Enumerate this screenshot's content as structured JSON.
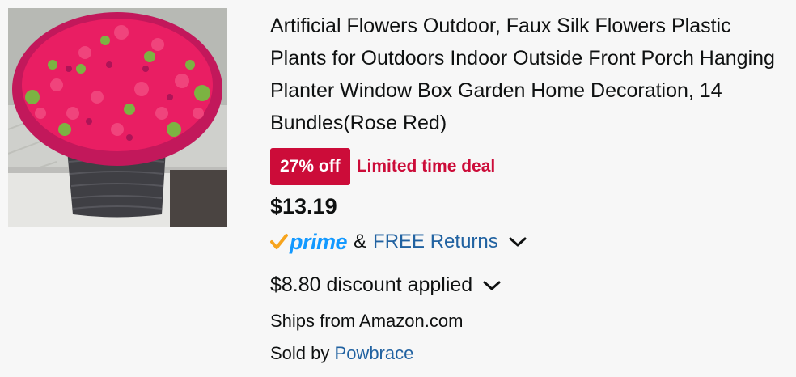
{
  "product": {
    "image_alt": "Rose red artificial flowers in dark woven planter",
    "title": "Artificial Flowers Outdoor, Faux Silk Flowers Plastic Plants for Outdoors Indoor Outside Front Porch Hanging Planter Window Box Garden Home Decoration, 14 Bundles(Rose Red)",
    "deal_badge": "27% off",
    "deal_text": "Limited time deal",
    "price": "$13.19",
    "prime_label": "prime",
    "amp": "&",
    "returns_label": "FREE Returns",
    "discount_label": "$8.80 discount applied",
    "ships_label": "Ships from Amazon.com",
    "sold_by_prefix": "Sold by",
    "seller_name": "Powbrace"
  },
  "colors": {
    "deal_red": "#cc0c39",
    "link_blue": "#2162a1",
    "prime_blue": "#1399ff",
    "prime_check": "#f7a41d",
    "background": "#f7f7f7"
  },
  "icons": {
    "prime_check": "check-icon",
    "chevron": "chevron-down-icon"
  }
}
